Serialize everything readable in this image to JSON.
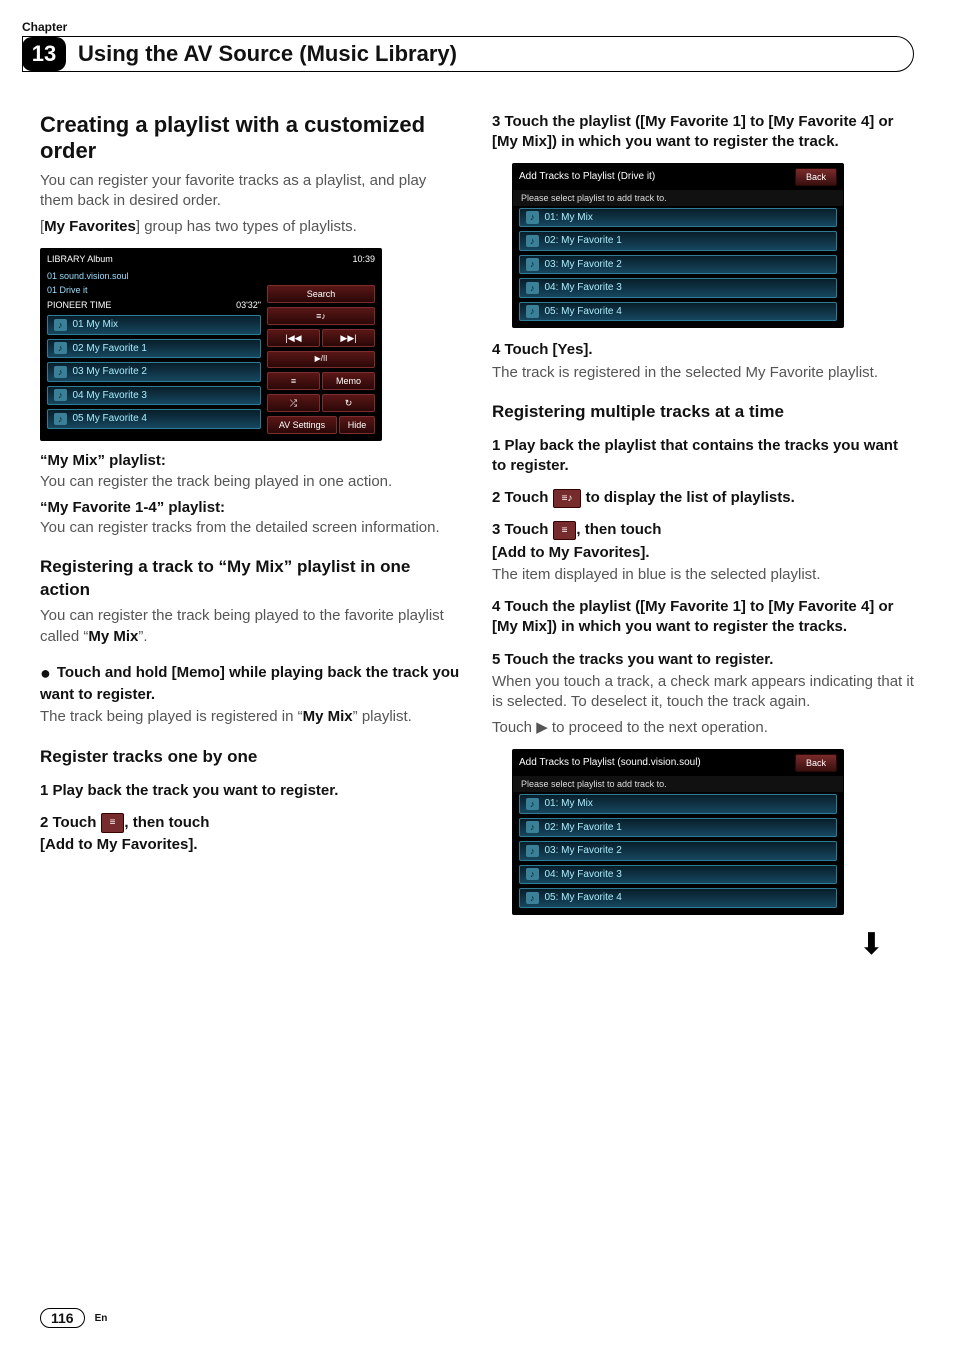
{
  "header": {
    "chapter_label": "Chapter",
    "chapter_number": "13",
    "chapter_title": "Using the AV Source (Music Library)"
  },
  "left": {
    "h2": "Creating a playlist with a customized order",
    "intro1": "You can register your favorite tracks as a playlist, and play them back in desired order.",
    "intro2a": "[",
    "intro2bold": "My Favorites",
    "intro2b": "] group has two types of playlists.",
    "ss1": {
      "topLeft": "LIBRARY  Album",
      "topRight": "10:39",
      "line1": "01 sound.vision.soul",
      "line2": "01 Drive it",
      "badge1": "PIONEER TIME",
      "badge2": "03'32\"",
      "items": [
        "01 My Mix",
        "02 My Favorite 1",
        "03 My Favorite 2",
        "04 My Favorite 3",
        "05 My Favorite 4"
      ],
      "btnSearch": "Search",
      "btnMemo": "Memo",
      "btnAV": "AV Settings",
      "btnHide": "Hide"
    },
    "mymix_h": "“My Mix” playlist:",
    "mymix_p": "You can register the track being played in one action.",
    "myfav_h": "“My Favorite 1-4” playlist:",
    "myfav_p": "You can register tracks from the detailed screen information.",
    "sub1": "Registering a track to “My Mix” playlist in one action",
    "sub1_p": "You can register the track being played to the favorite playlist called “",
    "sub1_bold": "My Mix",
    "sub1_p2": "”.",
    "bullet1": "Touch and hold [Memo] while playing back the track you want to register.",
    "bullet1_after1": "The track being played is registered in “",
    "bullet1_after_bold": "My Mix",
    "bullet1_after2": "” playlist.",
    "sub2": "Register tracks one by one",
    "step1": "1    Play back the track you want to register.",
    "step2a": "2    Touch ",
    "step2b": ", then touch",
    "step2c": "[Add to My Favorites]."
  },
  "right": {
    "step3": "3    Touch the playlist ([My Favorite 1] to [My Favorite 4] or [My Mix]) in which you want to register the track.",
    "ss2": {
      "title": "Add Tracks to Playlist (Drive it)",
      "back": "Back",
      "sub": "Please select playlist to add track to.",
      "items": [
        "01: My Mix",
        "02: My Favorite 1",
        "03: My Favorite 2",
        "04: My Favorite 3",
        "05: My Favorite 4"
      ]
    },
    "step4": "4    Touch [Yes].",
    "step4_after": "The track is registered in the selected My Favorite playlist.",
    "sub3": "Registering multiple tracks at a time",
    "m_step1": "1    Play back the playlist that contains the tracks you want to register.",
    "m_step2a": "2    Touch ",
    "m_step2b": " to display the list of playlists.",
    "m_step3a": "3    Touch ",
    "m_step3b": ", then touch",
    "m_step3c": "[Add to My Favorites].",
    "m_step3_after": "The item displayed in blue is the selected playlist.",
    "m_step4": "4    Touch the playlist ([My Favorite 1] to [My Favorite 4] or [My Mix]) in which you want to register the tracks.",
    "m_step5": "5    Touch the tracks you want to register.",
    "m_step5_after1": "When you touch a track, a check mark appears indicating that it is selected. To deselect it, touch the track again.",
    "m_step5_after2": "Touch ▶ to proceed to the next operation.",
    "ss3": {
      "title": "Add Tracks to Playlist (sound.vision.soul)",
      "back": "Back",
      "sub": "Please select playlist to add track to.",
      "items": [
        "01: My Mix",
        "02: My Favorite 1",
        "03: My Favorite 2",
        "04: My Favorite 3",
        "05: My Favorite 4"
      ]
    }
  },
  "footer": {
    "page": "116",
    "lang": "En"
  }
}
